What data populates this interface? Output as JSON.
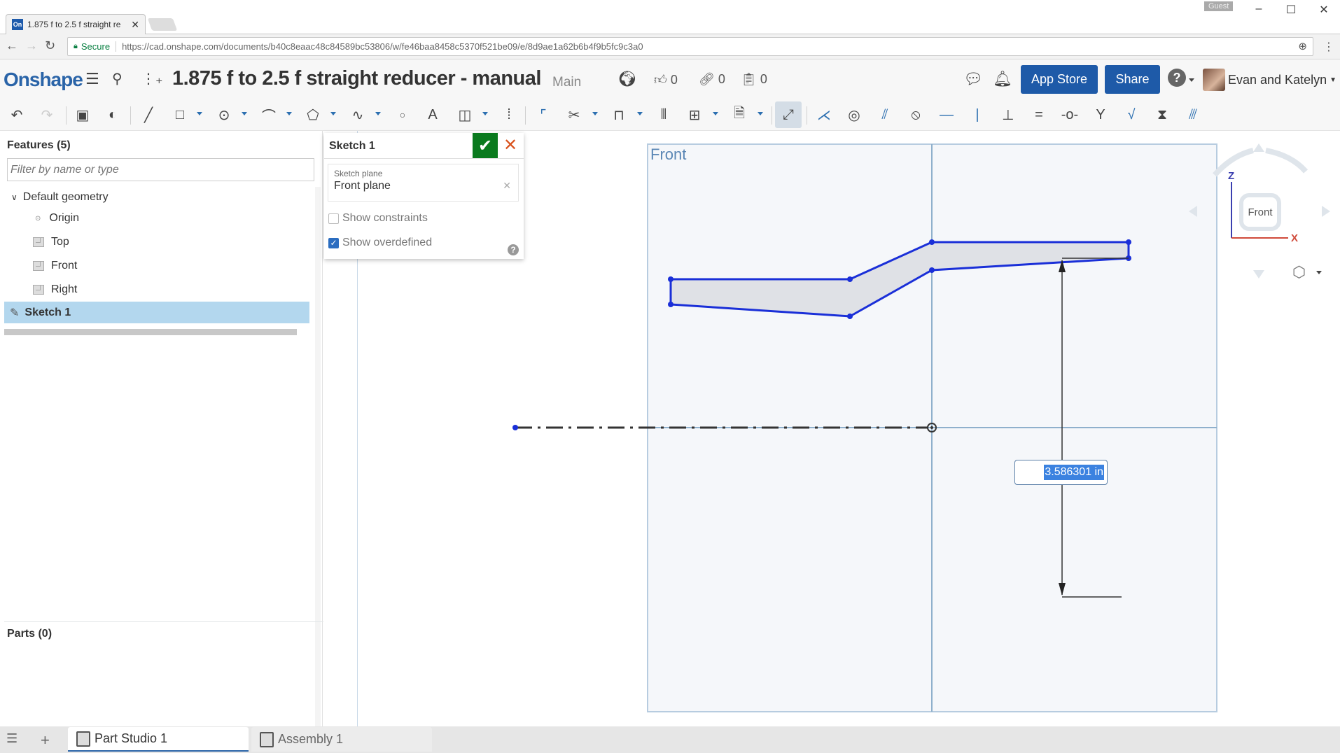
{
  "browser": {
    "tab_title": "1.875 f to 2.5 f straight re",
    "favicon": "On",
    "guest_label": "Guest",
    "secure_label": "Secure",
    "url": "https://cad.onshape.com/documents/b40c8eaac48c84589bc53806/w/fe46baa8458c5370f521be09/e/8d9ae1a62b6b4f9b5fc9c3a0"
  },
  "header": {
    "logo": "Onshape",
    "document_title": "1.875 f to 2.5 f straight reducer - manual",
    "branch": "Main",
    "likes": "0",
    "links": "0",
    "copies": "0",
    "app_store_label": "App Store",
    "share_label": "Share",
    "user_name": "Evan and Katelyn"
  },
  "toolbar": {
    "tools": [
      "undo",
      "redo",
      "part-studio-feature",
      "revolve",
      "line",
      "rectangle",
      "circle",
      "arc",
      "polygon",
      "spline",
      "point",
      "text",
      "construction",
      "use",
      "fillet",
      "trim",
      "offset",
      "mirror",
      "pattern",
      "dxf-import",
      "dimension",
      "coincident",
      "concentric",
      "parallel",
      "tangent",
      "horizontal",
      "vertical",
      "perpendicular",
      "equal",
      "midpoint",
      "normal",
      "pierce",
      "symmetric",
      "fix"
    ]
  },
  "features": {
    "header": "Features (5)",
    "filter_placeholder": "Filter by name or type",
    "group_label": "Default geometry",
    "items": [
      {
        "label": "Origin",
        "icon": "origin-icon"
      },
      {
        "label": "Top",
        "icon": "plane-icon"
      },
      {
        "label": "Front",
        "icon": "plane-icon"
      },
      {
        "label": "Right",
        "icon": "plane-icon"
      }
    ],
    "selected_item": "Sketch 1"
  },
  "parts": {
    "header": "Parts (0)"
  },
  "sketch_dialog": {
    "title": "Sketch 1",
    "plane_label": "Sketch plane",
    "plane_value": "Front plane",
    "show_constraints_label": "Show constraints",
    "show_constraints_checked": false,
    "show_overdefined_label": "Show overdefined",
    "show_overdefined_checked": true
  },
  "viewport": {
    "plane_name": "Front",
    "dimension_value": "3.586301 in",
    "view_cube_face": "Front",
    "axis_z": "Z",
    "axis_x": "X"
  },
  "bottom_tabs": [
    {
      "label": "Part Studio 1",
      "active": true
    },
    {
      "label": "Assembly 1",
      "active": false
    }
  ],
  "colors": {
    "brand": "#2a64a8",
    "sketch_line": "#1a2fd8",
    "accept": "#0a7a1e",
    "cancel": "#d9531e"
  }
}
